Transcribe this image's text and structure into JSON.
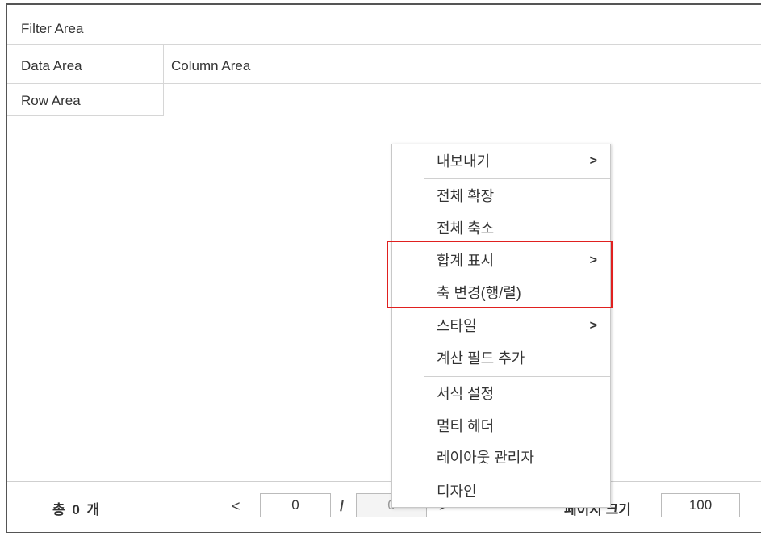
{
  "pivot": {
    "filter_area": "Filter Area",
    "data_area": "Data Area",
    "column_area": "Column Area",
    "row_area": "Row Area"
  },
  "footer": {
    "total": "총 0 개",
    "prev": "<",
    "current_page": "0",
    "separator": "/",
    "total_pages": "0",
    "next": ">",
    "page_size_label": "페이지 크기",
    "page_size": "100"
  },
  "context_menu": {
    "items": [
      {
        "label": "내보내기",
        "submenu": ">"
      },
      {
        "label": "전체 확장"
      },
      {
        "label": "전체 축소"
      },
      {
        "label": "합계 표시",
        "submenu": ">"
      },
      {
        "label": "축 변경(행/렬)"
      },
      {
        "label": "스타일",
        "submenu": ">"
      },
      {
        "label": "계산 필드 추가"
      },
      {
        "label": "서식 설정"
      },
      {
        "label": "멀티 헤더"
      },
      {
        "label": "레이아웃 관리자"
      },
      {
        "label": "디자인"
      }
    ],
    "highlight_color": "#e0201f"
  }
}
